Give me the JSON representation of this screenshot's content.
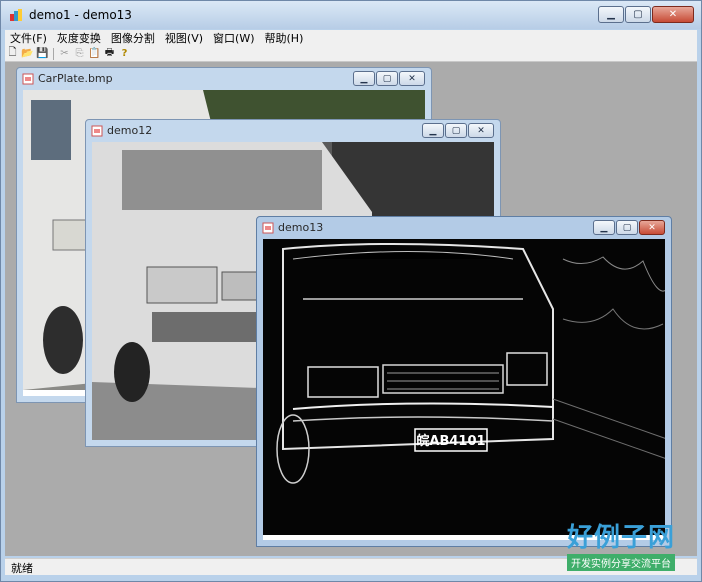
{
  "app": {
    "title": "demo1 - demo13"
  },
  "menubar": {
    "items": [
      "文件(F)",
      "灰度变换",
      "图像分割",
      "视图(V)",
      "窗口(W)",
      "帮助(H)"
    ]
  },
  "toolbar": {
    "buttons": [
      {
        "icon": "new-file-icon",
        "glyph": "🗋",
        "enabled": true
      },
      {
        "icon": "open-folder-icon",
        "glyph": "📂",
        "enabled": true
      },
      {
        "icon": "save-icon",
        "glyph": "💾",
        "enabled": true
      },
      {
        "icon": "cut-icon",
        "glyph": "✂",
        "enabled": false
      },
      {
        "icon": "copy-icon",
        "glyph": "⎘",
        "enabled": false
      },
      {
        "icon": "paste-icon",
        "glyph": "📋",
        "enabled": false
      },
      {
        "icon": "print-icon",
        "glyph": "🖶",
        "enabled": true
      },
      {
        "icon": "help-icon",
        "glyph": "?",
        "enabled": true
      }
    ]
  },
  "windows": [
    {
      "id": "carplate",
      "title": "CarPlate.bmp",
      "image": "color car photo"
    },
    {
      "id": "demo12",
      "title": "demo12",
      "image": "grayscale car photo"
    },
    {
      "id": "demo13",
      "title": "demo13",
      "image": "edge-detected car image",
      "plate_text": "皖AB4101"
    }
  ],
  "statusbar": {
    "text": "就绪"
  },
  "watermark": {
    "main": "好例子网",
    "sub": "开发实例分享交流平台"
  },
  "colors": {
    "titlebar_close": "#c74b35",
    "mdi_background": "#ababab",
    "watermark_blue": "#3aa0d8",
    "watermark_green": "#3fae6a"
  }
}
